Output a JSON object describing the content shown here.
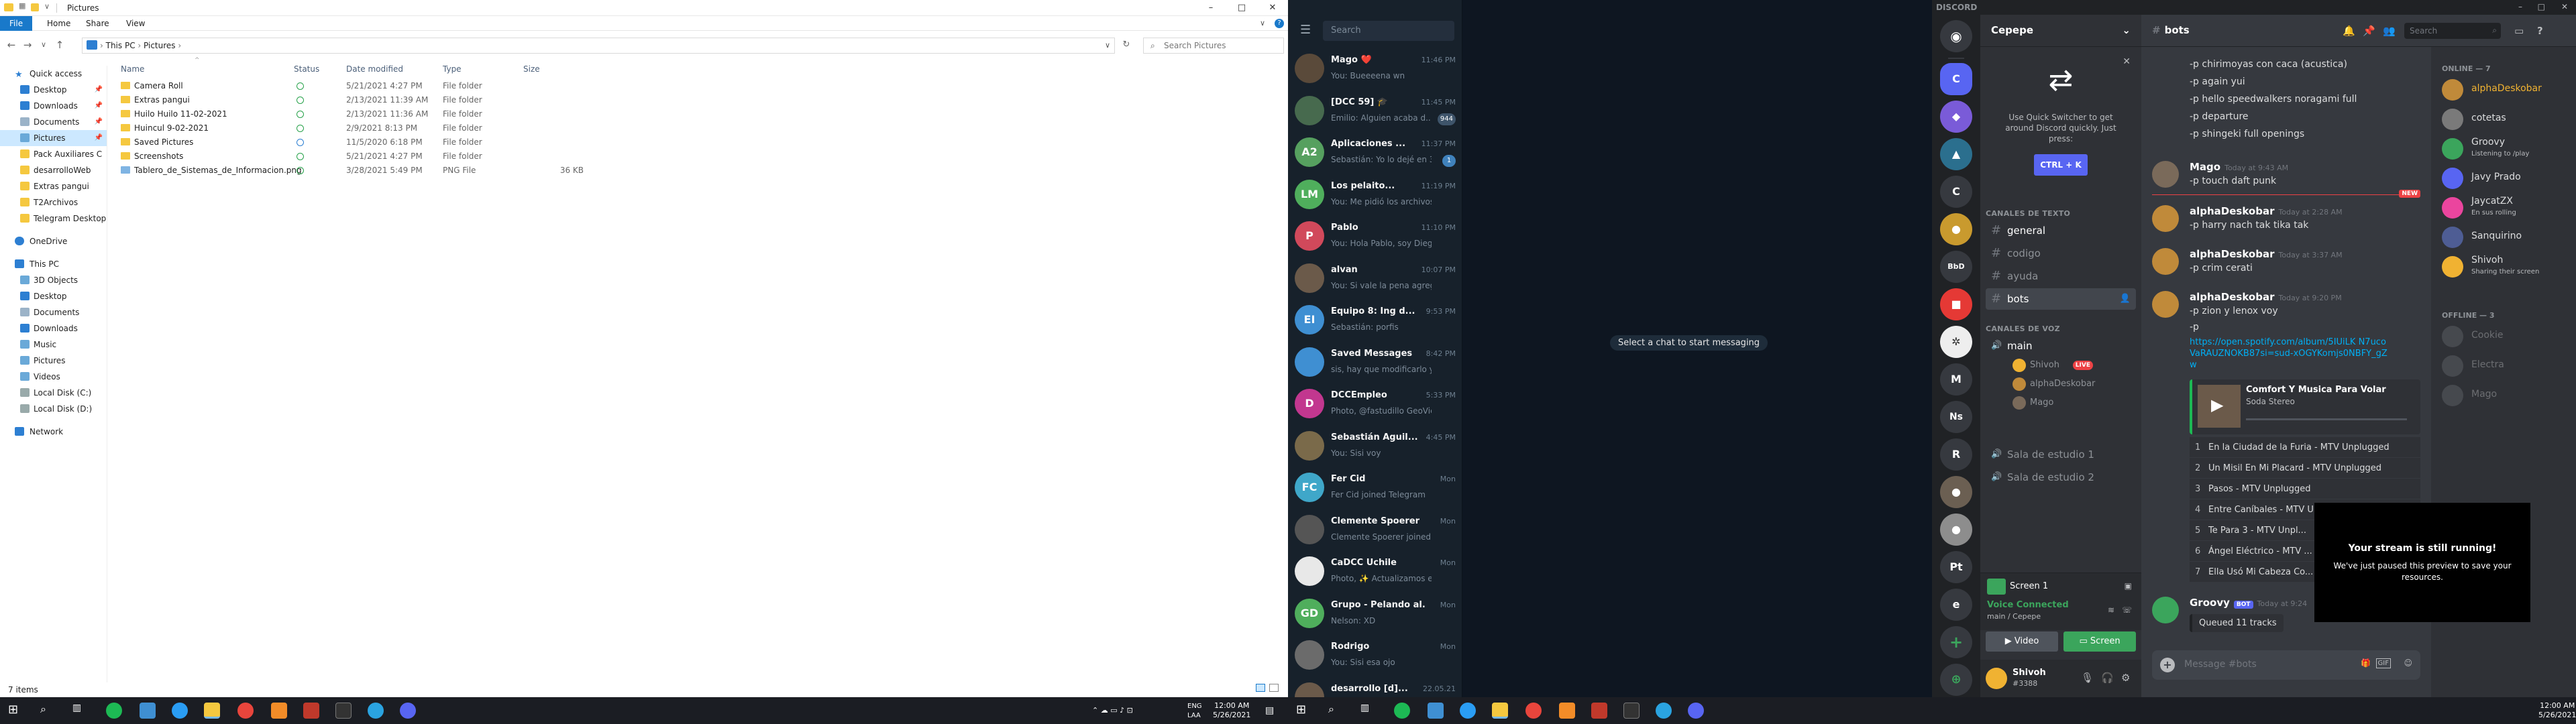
{
  "explorer": {
    "title": "Pictures",
    "ribbon_tabs": [
      "File",
      "Home",
      "Share",
      "View"
    ],
    "path": [
      "This PC",
      "Pictures"
    ],
    "search_placeholder": "Search Pictures",
    "nav": {
      "quick_access": "Quick access",
      "quick": [
        "Desktop",
        "Downloads",
        "Documents",
        "Pictures",
        "Pack Auxiliares C",
        "desarrolloWeb",
        "Extras pangui",
        "T2Archivos",
        "Telegram Desktop"
      ],
      "onedrive": "OneDrive",
      "this_pc": "This PC",
      "pc_items": [
        "3D Objects",
        "Desktop",
        "Documents",
        "Downloads",
        "Music",
        "Pictures",
        "Videos",
        "Local Disk (C:)",
        "Local Disk (D:)"
      ],
      "network": "Network"
    },
    "columns": [
      "Name",
      "Status",
      "Date modified",
      "Type",
      "Size"
    ],
    "files": [
      {
        "name": "Camera Roll",
        "date": "5/21/2021 4:27 PM",
        "type": "File folder",
        "size": ""
      },
      {
        "name": "Extras pangui",
        "date": "2/13/2021 11:39 AM",
        "type": "File folder",
        "size": ""
      },
      {
        "name": "Huilo Huilo 11-02-2021",
        "date": "2/13/2021 11:36 AM",
        "type": "File folder",
        "size": ""
      },
      {
        "name": "Huincul 9-02-2021",
        "date": "2/9/2021 8:13 PM",
        "type": "File folder",
        "size": ""
      },
      {
        "name": "Saved Pictures",
        "date": "11/5/2020 6:18 PM",
        "type": "File folder",
        "size": ""
      },
      {
        "name": "Screenshots",
        "date": "5/21/2021 4:27 PM",
        "type": "File folder",
        "size": ""
      },
      {
        "name": "Tablero_de_Sistemas_de_Informacion.png",
        "date": "3/28/2021 5:49 PM",
        "type": "PNG File",
        "size": "36 KB"
      }
    ],
    "status_text": "7 items"
  },
  "telegram": {
    "search_placeholder": "Search",
    "center_text": "Select a chat to start messaging",
    "chats": [
      {
        "name": "Mago ❤️",
        "time": "11:46 PM",
        "preview": "You: Bueeeena wn",
        "badge": "",
        "initials": "",
        "color": "#5a4a3a"
      },
      {
        "name": "[DCC 59] 🎓",
        "time": "11:45 PM",
        "preview": "Emilio: Alguien acaba d...",
        "badge": "944",
        "initials": "",
        "color": "#476a4e"
      },
      {
        "name": "Aplicaciones ...",
        "time": "11:37 PM",
        "preview": "Sebastián: Yo lo dejé en 3...",
        "badge": "1",
        "initials": "A2",
        "color": "#56a05f"
      },
      {
        "name": "Los pelaito...",
        "time": "11:19 PM",
        "preview": "You: Me pidió los archivos asi...",
        "badge": "",
        "initials": "LM",
        "color": "#4fae5c"
      },
      {
        "name": "Pablo",
        "time": "11:10 PM",
        "preview": "You: Hola Pablo, soy Diego y ...",
        "badge": "",
        "initials": "P",
        "color": "#d1495b"
      },
      {
        "name": "alvan",
        "time": "10:07 PM",
        "preview": "You: Si vale la pena agregarla...",
        "badge": "",
        "initials": "",
        "color": "#6b5a4a"
      },
      {
        "name": "Equipo 8: Ing d...",
        "time": "9:53 PM",
        "preview": "Sebastián: porfis",
        "badge": "",
        "initials": "EI",
        "color": "#3f8fd2"
      },
      {
        "name": "Saved Messages",
        "time": "8:42 PM",
        "preview": "sis, hay que modificarlo y us...",
        "badge": "",
        "initials": "",
        "color": "#3f8fd2"
      },
      {
        "name": "DCCEmpleo",
        "time": "5:33 PM",
        "preview": "Photo, @fastudillo GeoVicto...",
        "badge": "",
        "initials": "D",
        "color": "#c2378f"
      },
      {
        "name": "Sebastián Aguil...",
        "time": "4:45 PM",
        "preview": "You: Sisi voy",
        "badge": "",
        "initials": "",
        "color": "#7a6a4a"
      },
      {
        "name": "Fer Cid",
        "time": "Mon",
        "preview": "Fer Cid joined Telegram",
        "badge": "",
        "initials": "FC",
        "color": "#3fa7c9"
      },
      {
        "name": "Clemente Spoerer",
        "time": "Mon",
        "preview": "Clemente Spoerer joined Tel...",
        "badge": "",
        "initials": "",
        "color": "#555"
      },
      {
        "name": "CaDCC Uchile",
        "time": "Mon",
        "preview": "Photo, ✨ Actualizamos el ca...",
        "badge": "",
        "initials": "",
        "color": "#e8e8e8"
      },
      {
        "name": "Grupo - Pelando al...",
        "time": "Mon",
        "preview": "Nelson: XD",
        "badge": "",
        "initials": "GD",
        "color": "#4fae5c"
      },
      {
        "name": "Rodrigo",
        "time": "Mon",
        "preview": "You: Sisi esa ojo",
        "badge": "",
        "initials": "",
        "color": "#6b6b6b"
      },
      {
        "name": "desarrollo [d]...",
        "time": "22.05.21",
        "preview": "",
        "badge": "",
        "initials": "",
        "color": "#6b5a4a"
      }
    ]
  },
  "discord": {
    "app_title": "DISCORD",
    "server_name": "Cepepe",
    "quick_switcher_text": "Use Quick Switcher to get around Discord quickly. Just press:",
    "quick_switcher_key": "CTRL + K",
    "text_category": "CANALES DE TEXTO",
    "text_channels": [
      "general",
      "codigo",
      "ayuda",
      "bots"
    ],
    "voice_category": "CANALES DE VOZ",
    "voice_channels": [
      "main",
      "Sala de estudio 1",
      "Sala de estudio 2"
    ],
    "voice_users": [
      "Shivoh",
      "alphaDeskobar",
      "Mago"
    ],
    "live_label": "LIVE",
    "screen_label": "Screen 1",
    "voice_connected": "Voice Connected",
    "voice_location": "main / Cepepe",
    "video_btn": "Video",
    "screen_btn": "Screen",
    "username": "Shivoh",
    "user_tag": "#3388",
    "channel_title": "bots",
    "search_placeholder": "Search",
    "lines_top": [
      "-p chirimoyas con caca (acustica)",
      "-p again yui",
      "-p hello speedwalkers noragami full",
      "-p departure",
      "-p shingeki full openings"
    ],
    "messages": [
      {
        "author": "Mago",
        "time": "Today at 9:43 AM",
        "text": "-p touch daft punk"
      },
      {
        "author": "alphaDeskobar",
        "time": "Today at 2:28 AM",
        "text": "-p harry nach tak tika tak"
      },
      {
        "author": "alphaDeskobar",
        "time": "Today at 3:37 AM",
        "text": "-p crim cerati"
      },
      {
        "author": "alphaDeskobar",
        "time": "Today at 9:20 PM",
        "text": "-p zion y lenox voy"
      }
    ],
    "new_label": "NEW",
    "link_text": "https://open.spotify.com/album/5IUiLK N7ucoVaRAUZNOKB87si=sud-xOGYKomjs0NBFY_gZw",
    "embed_title": "Comfort Y Musica Para Volar",
    "embed_artist": "Soda Stereo",
    "tracks": [
      "En la Ciudad de la Furia - MTV Unplugged",
      "Un Misil En Mi Placard - MTV Unplugged",
      "Pasos - MTV Unplugged",
      "Entre Caníbales - MTV Unplugged",
      "Te Para 3 - MTV Unpl...",
      "Ángel Eléctrico - MTV ...",
      "Ella Usó Mi Cabeza Co..."
    ],
    "bot_author": "Groovy",
    "bot_tag": "BOT",
    "bot_time": "Today at 9:24",
    "queued": "Queued 11 tracks",
    "compose_placeholder": "Message #bots",
    "stream_title": "Your stream is still running!",
    "stream_text": "We've just paused this preview to save your resources.",
    "online_header": "ONLINE — 7",
    "offline_header": "OFFLINE — 3",
    "members_online": [
      {
        "name": "alphaDeskobar",
        "status": "",
        "color": "#c08a3a"
      },
      {
        "name": "cotetas",
        "status": "",
        "color": "#7a7a7a"
      },
      {
        "name": "Groovy",
        "status": "Listening to /play",
        "color": "#3ba55c"
      },
      {
        "name": "Javy Prado",
        "status": "",
        "color": "#5865f2"
      },
      {
        "name": "JaycatZX",
        "status": "En sus rolling",
        "color": "#eb459e"
      },
      {
        "name": "Sanquirino",
        "status": "",
        "color": "#4e5d94"
      },
      {
        "name": "Shivoh",
        "status": "Sharing their screen",
        "color": "#f0b232"
      }
    ],
    "members_offline": [
      "Cookie",
      "Electra",
      "Mago"
    ]
  },
  "taskbar": {
    "lang": "ENG",
    "lang2": "LAA",
    "time": "12:00 AM",
    "date": "5/26/2021"
  }
}
